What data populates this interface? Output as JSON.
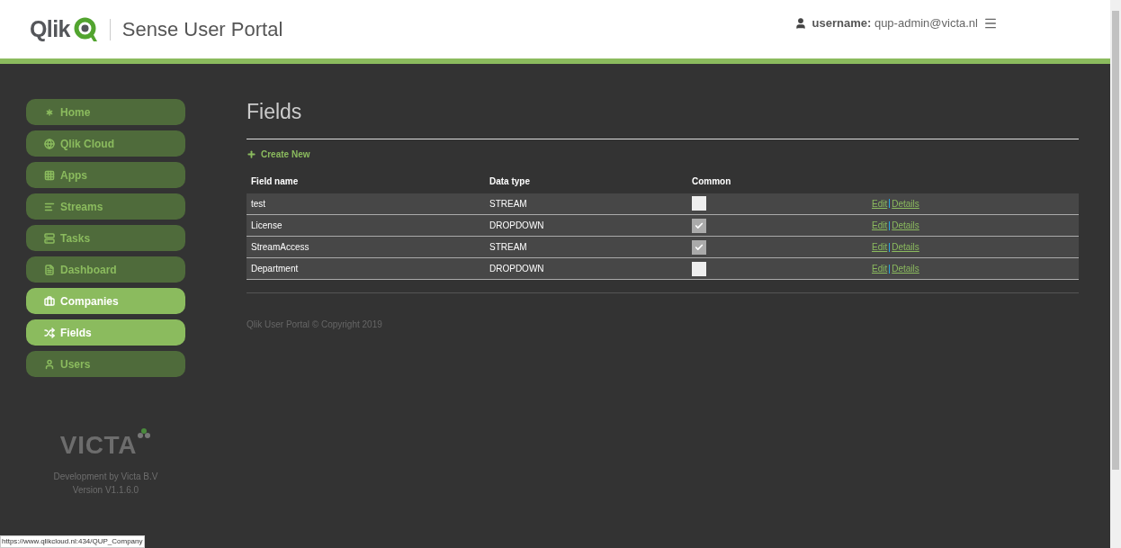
{
  "header": {
    "logo": "Qlik",
    "title": "Sense User Portal",
    "user_label": "username:",
    "user_value": "qup-admin@victa.nl"
  },
  "sidebar": {
    "items": [
      {
        "label": "Home",
        "selected": false
      },
      {
        "label": "Qlik Cloud",
        "selected": false
      },
      {
        "label": "Apps",
        "selected": false
      },
      {
        "label": "Streams",
        "selected": false
      },
      {
        "label": "Tasks",
        "selected": false
      },
      {
        "label": "Dashboard",
        "selected": false
      },
      {
        "label": "Companies",
        "selected": true
      },
      {
        "label": "Fields",
        "selected": true
      },
      {
        "label": "Users",
        "selected": false
      }
    ],
    "brand": "VICTA",
    "credit": "Development by Victa B.V",
    "version": "Version V1.1.6.0"
  },
  "page": {
    "title": "Fields",
    "create_new": "Create New"
  },
  "table": {
    "columns": [
      "Field name",
      "Data type",
      "Common"
    ],
    "rows": [
      {
        "name": "test",
        "type": "STREAM",
        "common": false,
        "edit": "Edit",
        "details": "Details"
      },
      {
        "name": "License",
        "type": "DROPDOWN",
        "common": true,
        "edit": "Edit",
        "details": "Details"
      },
      {
        "name": "StreamAccess",
        "type": "STREAM",
        "common": true,
        "edit": "Edit",
        "details": "Details"
      },
      {
        "name": "Department",
        "type": "DROPDOWN",
        "common": false,
        "edit": "Edit",
        "details": "Details"
      }
    ]
  },
  "footer": "Qlik User Portal © Copyright 2019",
  "status_bar": "https://www.qlikcloud.nl:434/QUP_Company"
}
